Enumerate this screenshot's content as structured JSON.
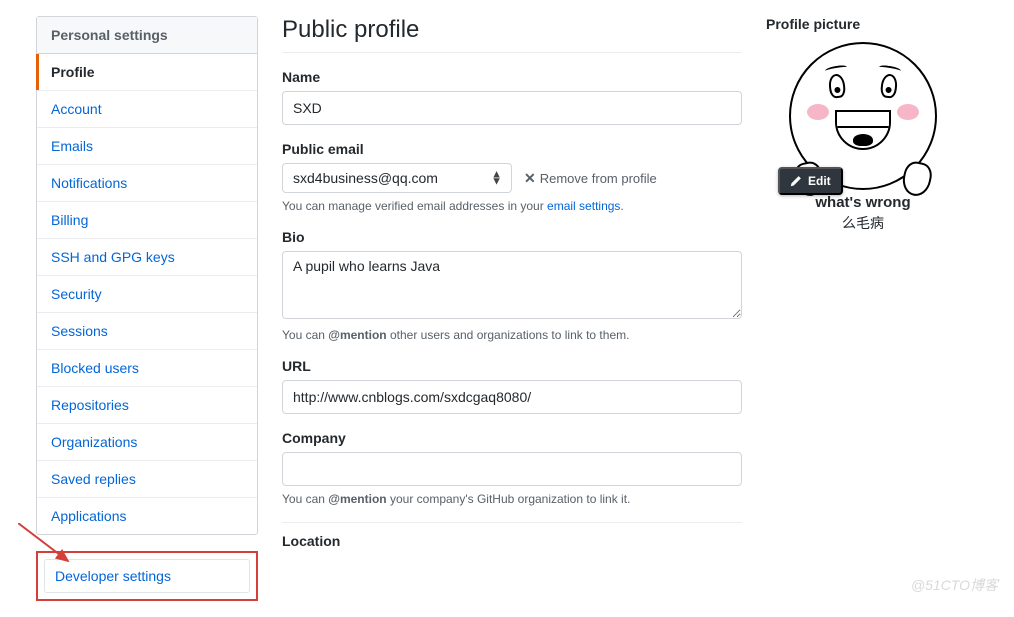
{
  "sidebar": {
    "header": "Personal settings",
    "items": [
      {
        "label": "Profile",
        "active": true
      },
      {
        "label": "Account"
      },
      {
        "label": "Emails"
      },
      {
        "label": "Notifications"
      },
      {
        "label": "Billing"
      },
      {
        "label": "SSH and GPG keys"
      },
      {
        "label": "Security"
      },
      {
        "label": "Sessions"
      },
      {
        "label": "Blocked users"
      },
      {
        "label": "Repositories"
      },
      {
        "label": "Organizations"
      },
      {
        "label": "Saved replies"
      },
      {
        "label": "Applications"
      }
    ],
    "developer_settings": "Developer settings"
  },
  "main": {
    "title": "Public profile",
    "name_label": "Name",
    "name_value": "SXD",
    "public_email_label": "Public email",
    "public_email_value": "sxd4business@qq.com",
    "remove_from_profile": "Remove from profile",
    "email_note_prefix": "You can manage verified email addresses in your ",
    "email_note_link": "email settings",
    "email_note_suffix": ".",
    "bio_label": "Bio",
    "bio_value": "A pupil who learns Java",
    "bio_note_prefix": "You can ",
    "bio_note_strong": "@mention",
    "bio_note_suffix": " other users and organizations to link to them.",
    "url_label": "URL",
    "url_value": "http://www.cnblogs.com/sxdcgaq8080/",
    "company_label": "Company",
    "company_value": "",
    "company_note_prefix": "You can ",
    "company_note_strong": "@mention",
    "company_note_suffix": " your company's GitHub organization to link it.",
    "location_label": "Location"
  },
  "right": {
    "heading": "Profile picture",
    "edit_label": "Edit",
    "avatar_caption": "what's wrong",
    "avatar_sub": "么毛病"
  },
  "watermark": "@51CTO博客"
}
